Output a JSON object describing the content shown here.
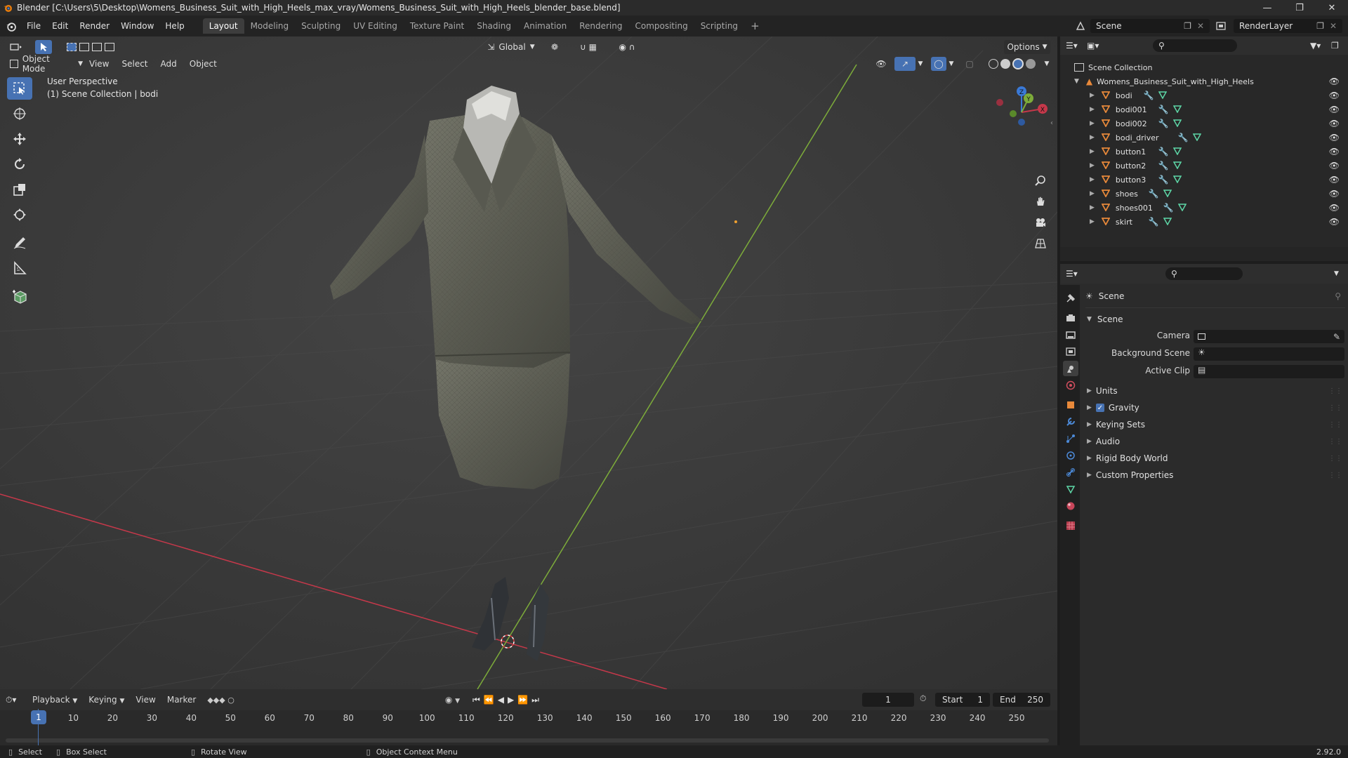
{
  "titlebar": {
    "title": "Blender [C:\\Users\\5\\Desktop\\Womens_Business_Suit_with_High_Heels_max_vray/Womens_Business_Suit_with_High_Heels_blender_base.blend]"
  },
  "menus": [
    "File",
    "Edit",
    "Render",
    "Window",
    "Help"
  ],
  "workspaces": [
    "Layout",
    "Modeling",
    "Sculpting",
    "UV Editing",
    "Texture Paint",
    "Shading",
    "Animation",
    "Rendering",
    "Compositing",
    "Scripting"
  ],
  "scene_name": "Scene",
  "view_layer": "RenderLayer",
  "viewport": {
    "mode": "Object Mode",
    "menus": [
      "View",
      "Select",
      "Add",
      "Object"
    ],
    "orientation": "Global",
    "options_label": "Options",
    "perspective": "User Perspective",
    "context": "(1) Scene Collection | bodi",
    "gizmo_axes": [
      "X",
      "Y",
      "Z"
    ]
  },
  "outliner": {
    "root": "Scene Collection",
    "collection": "Womens_Business_Suit_with_High_Heels",
    "objects": [
      "bodi",
      "bodi001",
      "bodi002",
      "bodi_driver",
      "button1",
      "button2",
      "button3",
      "shoes",
      "shoes001",
      "skirt"
    ]
  },
  "properties": {
    "breadcrumb": "Scene",
    "panel_title": "Scene",
    "fields": {
      "camera": "Camera",
      "background_scene": "Background Scene",
      "active_clip": "Active Clip"
    },
    "subpanels": [
      "Units",
      "Gravity",
      "Keying Sets",
      "Audio",
      "Rigid Body World",
      "Custom Properties"
    ],
    "gravity_checked": true
  },
  "timeline": {
    "menus": [
      "Playback",
      "Keying",
      "View",
      "Marker"
    ],
    "current_frame": "1",
    "start_label": "Start",
    "start": "1",
    "end_label": "End",
    "end": "250",
    "ticks": [
      "1",
      "10",
      "20",
      "30",
      "40",
      "50",
      "60",
      "70",
      "80",
      "90",
      "100",
      "110",
      "120",
      "130",
      "140",
      "150",
      "160",
      "170",
      "180",
      "190",
      "200",
      "210",
      "220",
      "230",
      "240",
      "250"
    ]
  },
  "statusbar": {
    "select": "Select",
    "box_select": "Box Select",
    "rotate_view": "Rotate View",
    "context_menu": "Object Context Menu",
    "version": "2.92.0"
  },
  "colors": {
    "accent": "#4772b3",
    "x_axis": "#c5384a",
    "y_axis": "#7dac3a",
    "z_axis": "#3a79d6",
    "mesh_orange": "#e8893a",
    "mesh_green": "#5ed7a7"
  }
}
